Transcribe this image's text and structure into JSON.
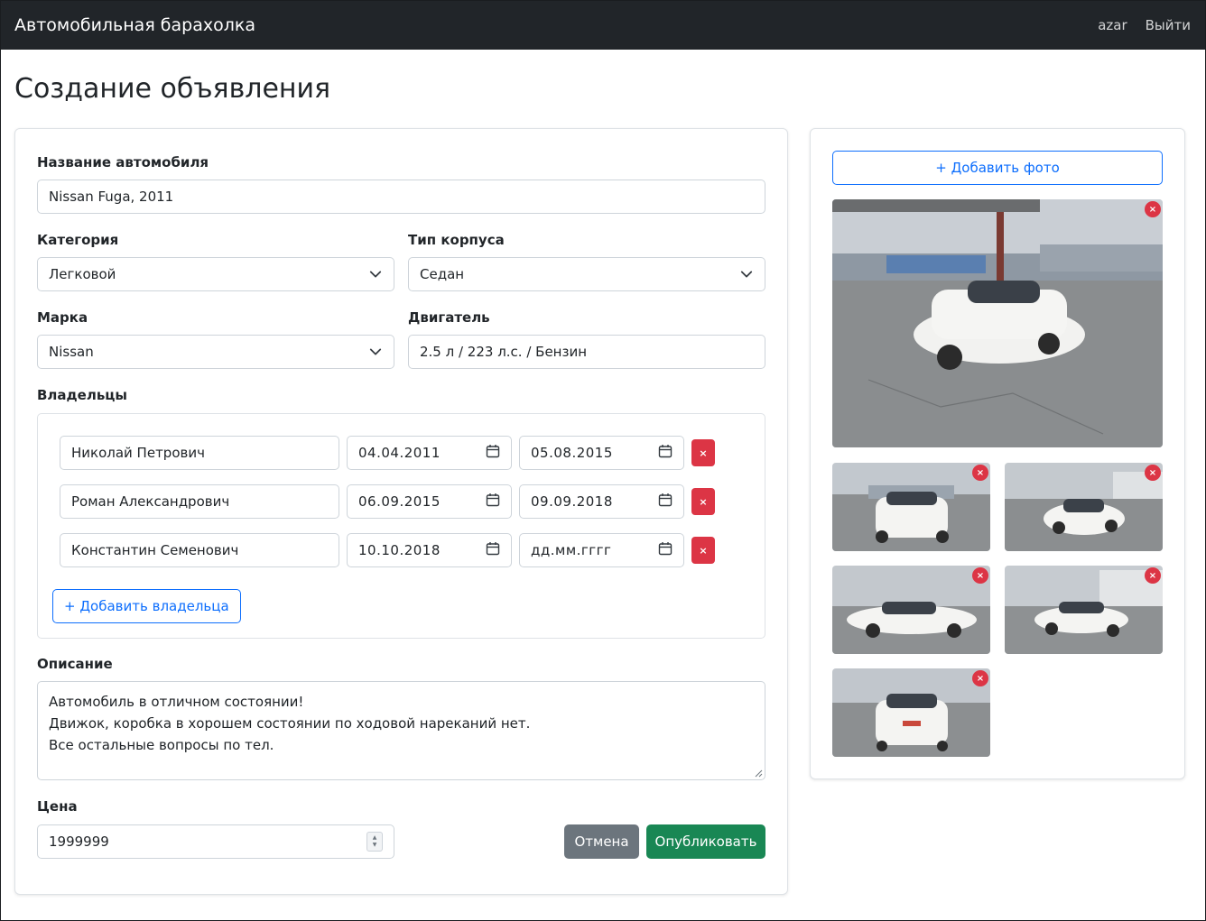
{
  "navbar": {
    "brand": "Автомобильная барахолка",
    "user": "azar",
    "logout": "Выйти"
  },
  "page_title": "Создание объявления",
  "form": {
    "car_name_label": "Название автомобиля",
    "car_name_value": "Nissan Fuga, 2011",
    "category_label": "Категория",
    "category_value": "Легковой",
    "body_label": "Тип корпуса",
    "body_value": "Седан",
    "brand_label": "Марка",
    "brand_value": "Nissan",
    "engine_label": "Двигатель",
    "engine_value": "2.5 л / 223 л.с. / Бензин",
    "owners_label": "Владельцы",
    "owners": [
      {
        "name": "Николай Петрович",
        "from": "04.04.2011",
        "to": "05.08.2015"
      },
      {
        "name": "Роман Александрович",
        "from": "06.09.2015",
        "to": "09.09.2018"
      },
      {
        "name": "Константин Семенович",
        "from": "10.10.2018",
        "to": "дд.мм.гггг"
      }
    ],
    "add_owner_label": "+ Добавить владельца",
    "delete_symbol": "×",
    "description_label": "Описание",
    "description_lines": [
      "Автомобиль в отличном состоянии!",
      "Движок, коробка в хорошем состоянии по ходовой нареканий нет.",
      "Все остальные вопросы по тел."
    ],
    "price_label": "Цена",
    "price_value": "1999999",
    "cancel_label": "Отмена",
    "publish_label": "Опубликовать"
  },
  "photos": {
    "add_photo_label": "+ Добавить фото",
    "remove_symbol": "×",
    "count": 6
  },
  "colors": {
    "navbar": "#212529",
    "primary": "#0d6efd",
    "danger": "#dc3545",
    "success": "#198754",
    "secondary": "#6c757d"
  }
}
